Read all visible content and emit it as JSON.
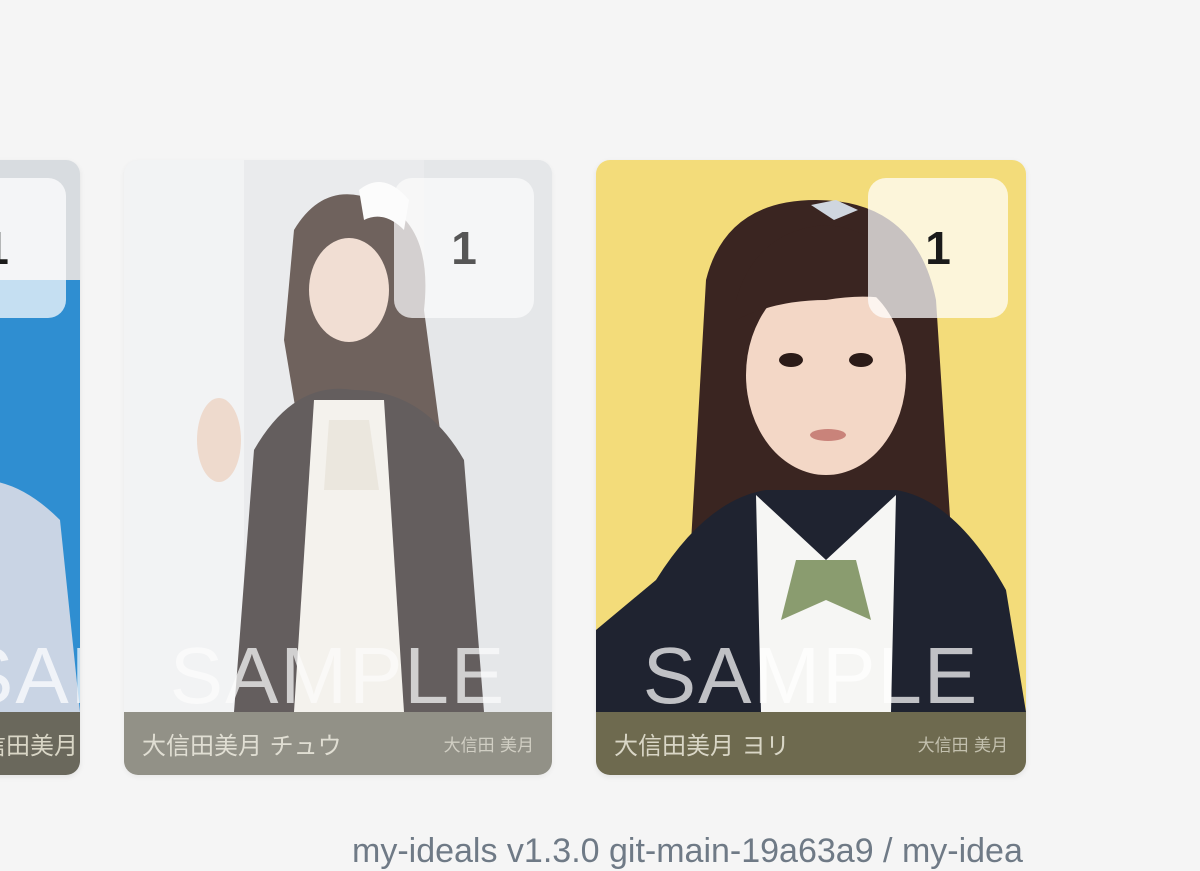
{
  "cards": [
    {
      "quantity": "1",
      "watermark": "SAMPLE",
      "caption_title": "大信田美月",
      "caption_sign": "大信田 美月"
    },
    {
      "quantity": "1",
      "watermark": "SAMPLE",
      "caption_title": "大信田美月 チュウ",
      "caption_sign": "大信田 美月"
    },
    {
      "quantity": "1",
      "watermark": "SAMPLE",
      "caption_title": "大信田美月 ヨリ",
      "caption_sign": "大信田 美月"
    }
  ],
  "footer": {
    "version_text": "my-ideals v1.3.0 git-main-19a63a9 / my-idea"
  },
  "colors": {
    "page_background": "#f5f5f5",
    "card3_background": "#f3dc7a",
    "caption_text": "#d9d6c6"
  }
}
